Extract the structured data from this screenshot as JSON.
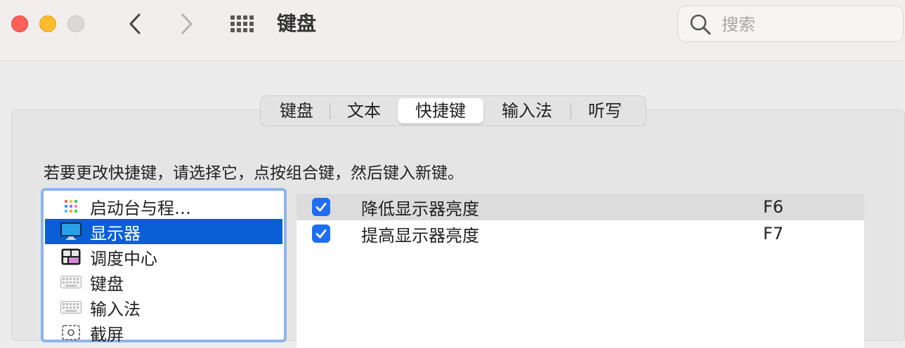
{
  "window": {
    "title": "键盘",
    "search_placeholder": "搜索"
  },
  "tabs": [
    {
      "label": "键盘"
    },
    {
      "label": "文本"
    },
    {
      "label": "快捷键",
      "selected": true
    },
    {
      "label": "输入法"
    },
    {
      "label": "听写"
    }
  ],
  "instruction": "若要更改快捷键，请选择它，点按组合键，然后键入新键。",
  "categories": [
    {
      "label": "启动台与程…",
      "icon": "launchpad-icon"
    },
    {
      "label": "显示器",
      "icon": "display-icon",
      "selected": true
    },
    {
      "label": "调度中心",
      "icon": "mission-control-icon"
    },
    {
      "label": "键盘",
      "icon": "keyboard-icon"
    },
    {
      "label": "输入法",
      "icon": "keyboard-icon"
    },
    {
      "label": "截屏",
      "icon": "screenshot-icon"
    }
  ],
  "shortcuts": [
    {
      "checked": true,
      "name": "降低显示器亮度",
      "key": "F6"
    },
    {
      "checked": true,
      "name": "提高显示器亮度",
      "key": "F7"
    }
  ],
  "colors": {
    "accent": "#0a5fd6",
    "checkbox": "#1f6ef2",
    "close": "#fe5f57",
    "minimize": "#febc2e"
  }
}
